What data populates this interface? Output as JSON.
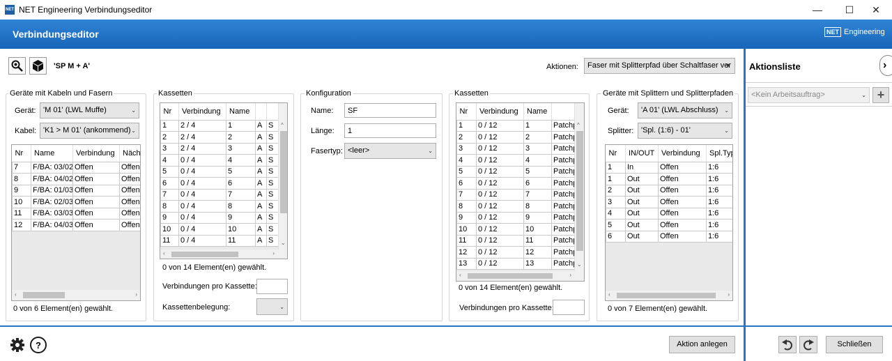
{
  "window": {
    "app_icon_text": "NET",
    "title": "NET Engineering Verbindungseditor",
    "min_glyph": "—",
    "max_glyph": "☐",
    "close_glyph": "✕"
  },
  "header": {
    "title": "Verbindungseditor",
    "logo_box": "NET",
    "logo_text": "Engineering",
    "colors": {
      "band": "#1f6fc5",
      "separator": "#2a74c6"
    }
  },
  "toolbar": {
    "object_name": "'SP M + A'",
    "actions_label": "Aktionen:",
    "actions_value": "Faser mit Splitterpfad über Schaltfaser ver"
  },
  "left_panel": {
    "group_title": "Geräte mit Kabeln und Fasern",
    "device_label": "Gerät:",
    "device_value": "'M 01' (LWL Muffe)",
    "cable_label": "Kabel:",
    "cable_value": "'K1 > M 01' (ankommend)",
    "columns": [
      "Nr",
      "Name",
      "Verbindung",
      "Näch"
    ],
    "rows": [
      [
        "7",
        "F/BA: 03/02",
        "Offen",
        "Offen"
      ],
      [
        "8",
        "F/BA: 04/02",
        "Offen",
        "Offen"
      ],
      [
        "9",
        "F/BA: 01/03",
        "Offen",
        "Offen"
      ],
      [
        "10",
        "F/BA: 02/03",
        "Offen",
        "Offen"
      ],
      [
        "11",
        "F/BA: 03/03",
        "Offen",
        "Offen"
      ],
      [
        "12",
        "F/BA: 04/03",
        "Offen",
        "Offen"
      ]
    ],
    "status": "0 von 6 Element(en) gewählt."
  },
  "cassettes_left": {
    "group_title": "Kassetten",
    "columns": [
      "Nr",
      "Verbindung",
      "Name",
      "",
      ""
    ],
    "rows": [
      [
        "1",
        "2 / 4",
        "1",
        "A",
        "S"
      ],
      [
        "2",
        "2 / 4",
        "2",
        "A",
        "S"
      ],
      [
        "3",
        "2 / 4",
        "3",
        "A",
        "S"
      ],
      [
        "4",
        "0 / 4",
        "4",
        "A",
        "S"
      ],
      [
        "5",
        "0 / 4",
        "5",
        "A",
        "S"
      ],
      [
        "6",
        "0 / 4",
        "6",
        "A",
        "S"
      ],
      [
        "7",
        "0 / 4",
        "7",
        "A",
        "S"
      ],
      [
        "8",
        "0 / 4",
        "8",
        "A",
        "S"
      ],
      [
        "9",
        "0 / 4",
        "9",
        "A",
        "S"
      ],
      [
        "10",
        "0 / 4",
        "10",
        "A",
        "S"
      ],
      [
        "11",
        "0 / 4",
        "11",
        "A",
        "S"
      ]
    ],
    "status": "0 von 14 Element(en) gewählt.",
    "per_cassette_label": "Verbindungen pro Kassette:",
    "per_cassette_value": "",
    "assignment_label": "Kassettenbelegung:",
    "assignment_value": ""
  },
  "config": {
    "group_title": "Konfiguration",
    "name_label": "Name:",
    "name_value": "SF",
    "length_label": "Länge:",
    "length_value": "1",
    "fibertype_label": "Fasertyp:",
    "fibertype_value": "<leer>"
  },
  "cassettes_right": {
    "group_title": "Kassetten",
    "columns": [
      "Nr",
      "Verbindung",
      "Name",
      ""
    ],
    "rows": [
      [
        "1",
        "0 / 12",
        "1",
        "Patchp"
      ],
      [
        "2",
        "0 / 12",
        "2",
        "Patchp"
      ],
      [
        "3",
        "0 / 12",
        "3",
        "Patchp"
      ],
      [
        "4",
        "0 / 12",
        "4",
        "Patchp"
      ],
      [
        "5",
        "0 / 12",
        "5",
        "Patchp"
      ],
      [
        "6",
        "0 / 12",
        "6",
        "Patchp"
      ],
      [
        "7",
        "0 / 12",
        "7",
        "Patchp"
      ],
      [
        "8",
        "0 / 12",
        "8",
        "Patchp"
      ],
      [
        "9",
        "0 / 12",
        "9",
        "Patchp"
      ],
      [
        "10",
        "0 / 12",
        "10",
        "Patchp"
      ],
      [
        "11",
        "0 / 12",
        "11",
        "Patchp"
      ],
      [
        "12",
        "0 / 12",
        "12",
        "Patchp"
      ],
      [
        "13",
        "0 / 12",
        "13",
        "Patchp"
      ]
    ],
    "status": "0 von 14 Element(en) gewählt.",
    "per_cassette_label": "Verbindungen pro Kassette:",
    "per_cassette_value": ""
  },
  "right_panel": {
    "group_title": "Geräte mit Splittern und Splitterpfaden",
    "device_label": "Gerät:",
    "device_value": "'A 01' (LWL Abschluss)",
    "splitter_label": "Splitter:",
    "splitter_value": "'Spl. (1:6) - 01'",
    "columns": [
      "Nr",
      "IN/OUT",
      "Verbindung",
      "Spl.Typ"
    ],
    "rows": [
      [
        "1",
        "In",
        "Offen",
        "1:6"
      ],
      [
        "1",
        "Out",
        "Offen",
        "1:6"
      ],
      [
        "2",
        "Out",
        "Offen",
        "1:6"
      ],
      [
        "3",
        "Out",
        "Offen",
        "1:6"
      ],
      [
        "4",
        "Out",
        "Offen",
        "1:6"
      ],
      [
        "5",
        "Out",
        "Offen",
        "1:6"
      ],
      [
        "6",
        "Out",
        "Offen",
        "1:6"
      ]
    ],
    "status": "0 von 7 Element(en) gewählt."
  },
  "footer": {
    "create_action": "Aktion anlegen",
    "close": "Schließen"
  },
  "action_list": {
    "title": "Aktionsliste",
    "work_order_placeholder": "<Kein Arbeitsauftrag>",
    "add_glyph": "+",
    "expand_glyph": "›"
  }
}
